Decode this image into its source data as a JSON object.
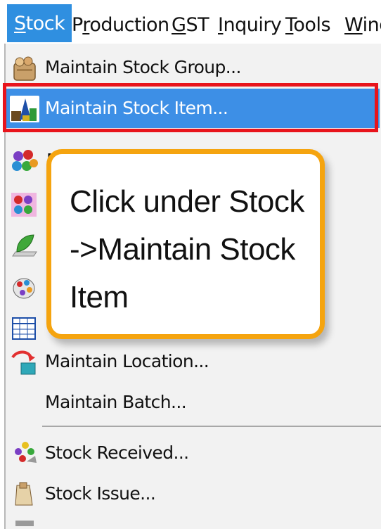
{
  "menubar": {
    "items": [
      {
        "label": "Stock",
        "mnemonic": "S"
      },
      {
        "label": "Production",
        "mnemonic": "r"
      },
      {
        "label": "GST",
        "mnemonic": "G"
      },
      {
        "label": "Inquiry",
        "mnemonic": "I"
      },
      {
        "label": "Tools",
        "mnemonic": "T"
      },
      {
        "label": "Wind",
        "mnemonic": "W"
      }
    ]
  },
  "dropdown": {
    "items": [
      {
        "label": "Maintain Stock Group...",
        "icon": "stock-group-icon"
      },
      {
        "label": "Maintain Stock Item...",
        "icon": "stock-item-icon",
        "selected": true
      },
      {
        "label": "",
        "icon": "colored-balls-icon"
      },
      {
        "label": "",
        "icon": "colored-balls-pink-icon"
      },
      {
        "label": "",
        "icon": "green-leaf-icon"
      },
      {
        "label": "",
        "icon": "paint-palette-icon"
      },
      {
        "label": "",
        "icon": "grid-table-icon"
      },
      {
        "label": "Maintain Location...",
        "icon": "location-arrow-icon"
      },
      {
        "label": "Maintain Batch...",
        "icon": ""
      },
      {
        "label": "Stock Received...",
        "icon": "stock-received-icon"
      },
      {
        "label": "Stock Issue...",
        "icon": "stock-issue-icon"
      }
    ]
  },
  "callout": {
    "lines": [
      "Click under Stock",
      "->Maintain Stock",
      "Item"
    ]
  },
  "colors": {
    "accent": "#2f8fe0",
    "selection": "#3d8fe6",
    "highlight_border": "#e8141c",
    "callout_border": "#f5a40f"
  }
}
